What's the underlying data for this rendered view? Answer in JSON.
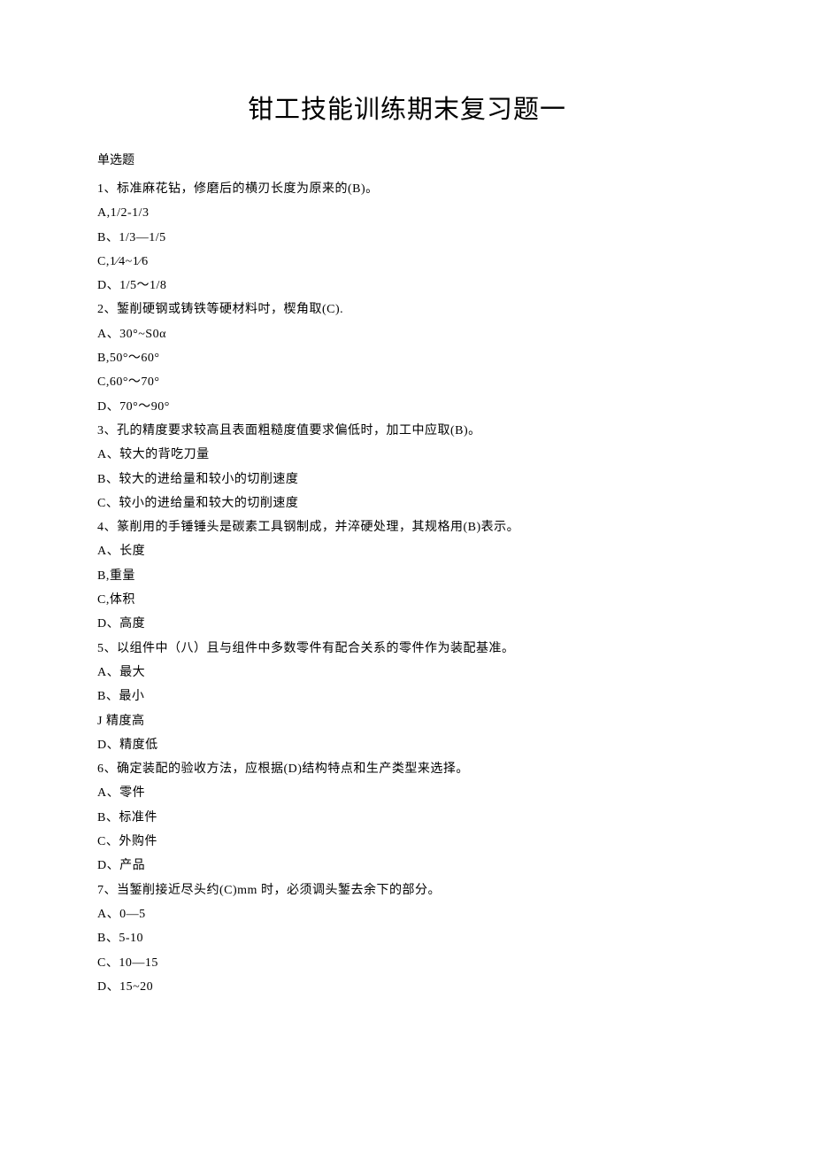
{
  "title": "钳工技能训练期末复习题一",
  "section_label": "单选题",
  "lines": [
    "1、标准麻花钻，修磨后的横刃长度为原来的(B)。",
    "A,1/2-1/3",
    "B、1/3—1/5",
    "C,1⁄4~1⁄6",
    "D、1/5～1/8",
    "2、錾削硬钢或铸铁等硬材料吋，楔角取(C).",
    "A、30°~S0α",
    "B,50°～60°",
    "C,60°～70°",
    "D、70°～90°",
    "3、孔的精度要求较高且表面粗糙度值要求偏低时，加工中应取(B)。",
    "A、较大的背吃刀量",
    "B、较大的进给量和较小的切削速度",
    "C、较小的进给量和较大的切削速度",
    "4、篆削用的手锤锤头是碳素工具钢制成，并淬硬处理，其规格用(B)表示。",
    "A、长度",
    "B,重量",
    "C,体积",
    "D、高度",
    "5、以组件中（八）且与组件中多数零件有配合关系的零件作为装配基准。",
    "A、最大",
    "B、最小",
    "J 精度高",
    "D、精度低",
    "6、确定装配的验收方法，应根据(D)结构特点和生产类型来选择。",
    "A、零件",
    "B、标准件",
    "C、外购件",
    "D、产品",
    "7、当錾削接近尽头约(C)mm 时，必须调头錾去余下的部分。",
    "A、0—5",
    "B、5-10",
    "C、10—15",
    "D、15~20"
  ]
}
